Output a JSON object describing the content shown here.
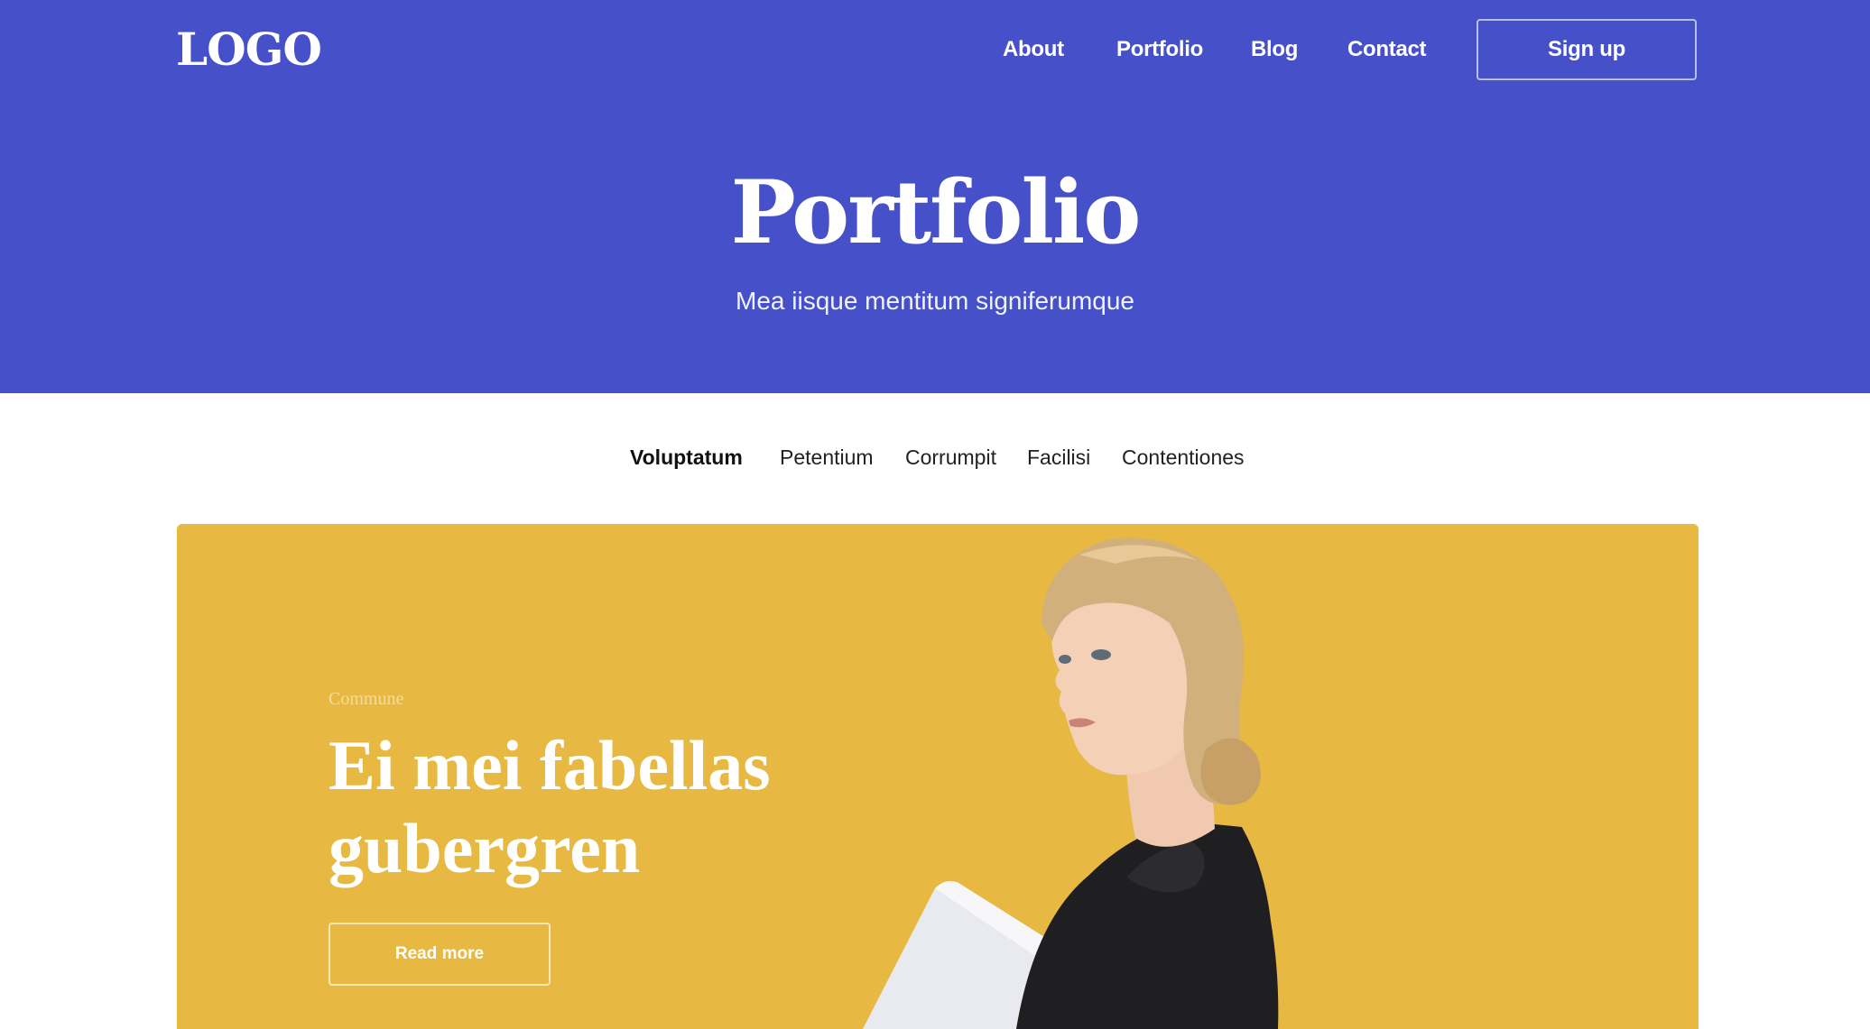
{
  "header": {
    "logo": "LOGO",
    "nav": [
      {
        "label": "About"
      },
      {
        "label": "Portfolio"
      },
      {
        "label": "Blog"
      },
      {
        "label": "Contact"
      }
    ],
    "signup_label": "Sign up"
  },
  "hero": {
    "title": "Portfolio",
    "subtitle": "Mea iisque mentitum signiferumque"
  },
  "tabs": [
    {
      "label": "Voluptatum",
      "active": true
    },
    {
      "label": "Petentium",
      "active": false
    },
    {
      "label": "Corrumpit",
      "active": false
    },
    {
      "label": "Facilisi",
      "active": false
    },
    {
      "label": "Contentiones",
      "active": false
    }
  ],
  "feature": {
    "eyebrow": "Commune",
    "headline": "Ei mei fabellas gubergren",
    "button_label": "Read more"
  },
  "colors": {
    "hero_bg": "#4650c9",
    "card_bg": "#e7b842"
  }
}
